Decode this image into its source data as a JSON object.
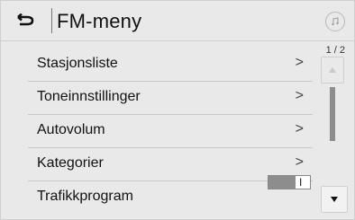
{
  "header": {
    "title": "FM-meny",
    "back_icon": "back-arrow-icon",
    "music_icon": "music-note-icon"
  },
  "scroll": {
    "page_indicator": "1 / 2"
  },
  "menu_items": [
    {
      "label": "Stasjonsliste",
      "chevron": ">"
    },
    {
      "label": "Toneinnstillinger",
      "chevron": ">"
    },
    {
      "label": "Autovolum",
      "chevron": ">"
    },
    {
      "label": "Kategorier",
      "chevron": ">"
    },
    {
      "label": "Trafikkprogram",
      "toggle_on_label": "I"
    }
  ]
}
